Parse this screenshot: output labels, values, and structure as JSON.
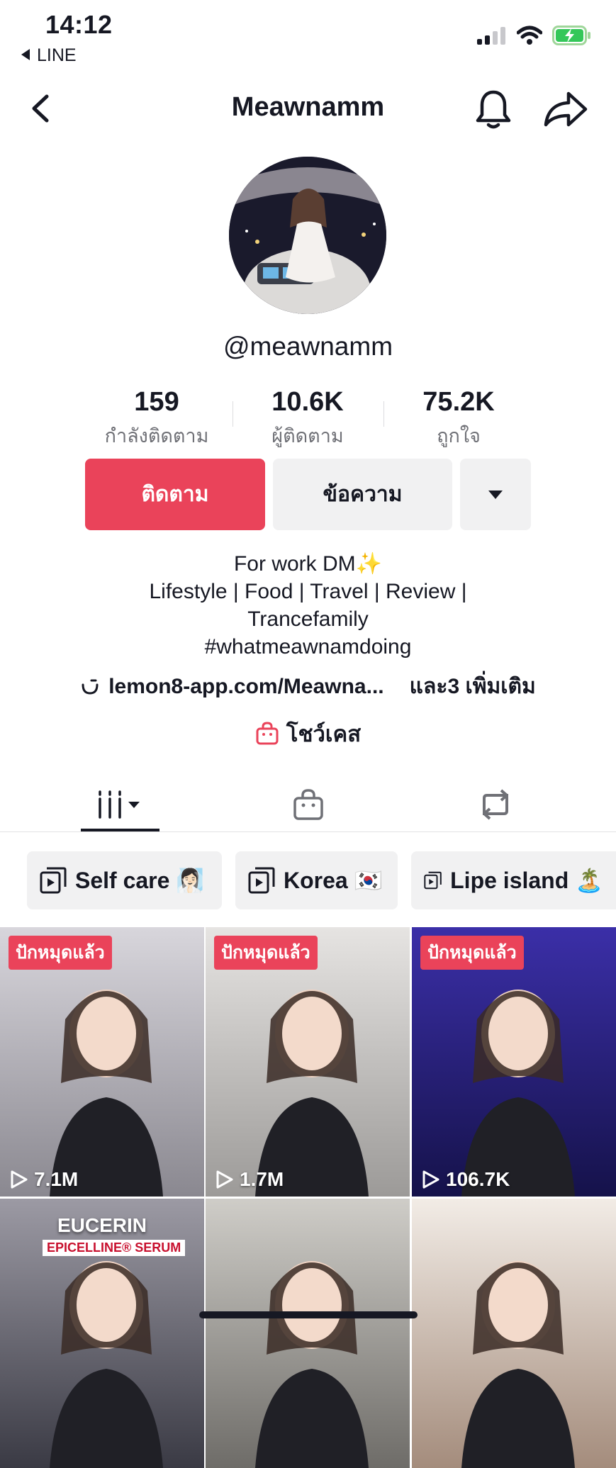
{
  "status_bar": {
    "time": "14:12",
    "back_app": "LINE"
  },
  "header": {
    "title": "Meawnamm"
  },
  "profile": {
    "handle": "@meawnamm",
    "stats": [
      {
        "value": "159",
        "label": "กำลังติดตาม"
      },
      {
        "value": "10.6K",
        "label": "ผู้ติดตาม"
      },
      {
        "value": "75.2K",
        "label": "ถูกใจ"
      }
    ],
    "follow_label": "ติดตาม",
    "message_label": "ข้อความ",
    "bio_lines": [
      "For work DM✨",
      "Lifestyle | Food | Travel | Review |",
      "Trancefamily",
      "#whatmeawnamdoing"
    ],
    "link_text": "lemon8-app.com/Meawna...",
    "more_links": "และ3 เพิ่มเติม",
    "showcase_label": "โชว์เคส"
  },
  "tabs": [
    "videos-tab",
    "shop-tab",
    "reposts-tab"
  ],
  "playlists": [
    {
      "label": "Self care 🧖🏻‍♀️"
    },
    {
      "label": "Korea 🇰🇷"
    },
    {
      "label": "Lipe island 🏝️"
    }
  ],
  "videos": [
    {
      "pinned": "ปักหมุดแล้ว",
      "views": "7.1M",
      "colors": [
        "#d8d6dc",
        "#8a8890"
      ]
    },
    {
      "pinned": "ปักหมุดแล้ว",
      "views": "1.7M",
      "colors": [
        "#e6e4e2",
        "#9c9a98"
      ]
    },
    {
      "pinned": "ปักหมุดแล้ว",
      "views": "106.7K",
      "colors": [
        "#3b2fa8",
        "#15124a"
      ]
    },
    {
      "pinned": "",
      "views": "",
      "caption": "EUCERIN",
      "subcaption": "EPICELLINE® SERUM",
      "colors": [
        "#9c9aa4",
        "#3a3a44"
      ]
    },
    {
      "pinned": "",
      "views": "",
      "colors": [
        "#cfcdc8",
        "#6e6c68"
      ]
    },
    {
      "pinned": "",
      "views": "",
      "colors": [
        "#f2ece6",
        "#a48c7c"
      ]
    }
  ]
}
